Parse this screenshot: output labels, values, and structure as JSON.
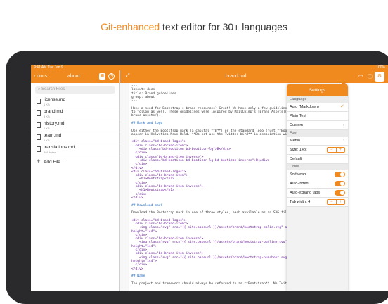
{
  "headline": {
    "accent": "Git-enhanced",
    "rest": " text editor for 30+ languages"
  },
  "statusbar": {
    "left": "9:41 AM  Tue Jan 9",
    "right": "100%"
  },
  "sidebar": {
    "back_label": "docs",
    "title": "about",
    "search_placeholder": "Search Files",
    "files": [
      {
        "name": "license.md",
        "meta": "1 KB"
      },
      {
        "name": "brand.md",
        "meta": "3 KB"
      },
      {
        "name": "history.md",
        "meta": "1 KB"
      },
      {
        "name": "team.md",
        "meta": "1 KB"
      },
      {
        "name": "translations.md",
        "meta": "486 bytes"
      }
    ],
    "add_label": "Add File..."
  },
  "editor": {
    "title": "brand.md",
    "lines": [
      "---",
      "layout: docs",
      "title: Brand guidelines",
      "group: about",
      "---",
      "",
      "Have a need for Bootstrap's brand resources? Great! We have only a few guideline",
      "to follow as well. These guidelines were inspired by MailChimp's [Brand Assets](",
      "brand-assets/).",
      "",
      "## Mark and logo",
      "",
      "Use either the Bootstrap mark (a capital **B**) or the standard logo (just **Boo",
      "appear in Helvetica Neue Bold. **Do not use the Twitter bird** in association wi",
      "",
      "<div class=\"bd-brand-logos\">",
      "  <div class=\"bd-brand-item\">",
      "    <div class=\"bd-booticon bd-booticon-lg\">B</div>",
      "  </div>",
      "  <div class=\"bd-brand-item inverse\">",
      "    <div class=\"bd-booticon bd-booticon-lg bd-booticon-inverse\">B</div>",
      "  </div>",
      "</div>",
      "<div class=\"bd-brand-logos\">",
      "  <div class=\"bd-brand-item\">",
      "    <h1>Bootstrap</h1>",
      "  </div>",
      "  <div class=\"bd-brand-item inverse\">",
      "    <h1>Bootstrap</h1>",
      "  </div>",
      "</div>",
      "",
      "## Download mark",
      "",
      "Download the Bootstrap mark in one of three styles, each available as an SVG fil",
      "",
      "<div class=\"bd-brand-logos\">",
      "  <div class=\"bd-brand-item\">",
      "    <img class=\"svg\" src=\"{{ site.baseurl }}/assets/brand/bootstrap-solid.svg\" a",
      "height=\"144\">",
      "  </div>",
      "  <div class=\"bd-brand-item inverse\">",
      "    <img class=\"svg\" src=\"{{ site.baseurl }}/assets/brand/bootstrap-outline.svg\"",
      "height=\"144\">",
      "  </div>",
      "  <div class=\"bd-brand-item inverse\">",
      "    <img class=\"svg\" src=\"{{ site.baseurl }}/assets/brand/bootstrap-punchout.svg",
      "height=\"144\">",
      "  </div>",
      "</div>",
      "",
      "## Name",
      "",
      "The project and framework should always be referred to as **Bootstrap**. No Twit"
    ]
  },
  "settings": {
    "title": "Settings",
    "language_header": "Language",
    "language_options": [
      "Auto (Markdown)",
      "Plain Text",
      "Custom"
    ],
    "selected_language": "Auto (Markdown)",
    "font_header": "Font",
    "font_name": "Menlo",
    "font_size_label": "Size: 14pt",
    "stepper_minus": "−",
    "stepper_plus": "+",
    "default_label": "Default",
    "lines_header": "Lines",
    "soft_wrap": "Soft wrap",
    "auto_indent": "Auto-indent",
    "auto_expand_tabs": "Auto-expand tabs",
    "tab_width_label": "Tab width: 4",
    "toggles": {
      "soft_wrap": true,
      "auto_indent": true,
      "auto_expand_tabs": true
    }
  },
  "colors": {
    "accent": "#f08a1e",
    "device": "#2a2a2c"
  }
}
